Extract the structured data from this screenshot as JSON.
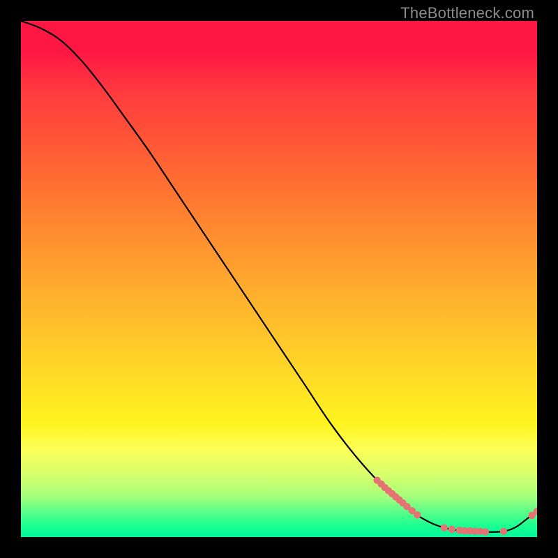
{
  "watermark": "TheBottleneck.com",
  "colors": {
    "line": "#000000",
    "dots": "#e57373",
    "background_black": "#000000"
  },
  "chart_data": {
    "type": "line",
    "title": "",
    "xlabel": "",
    "ylabel": "",
    "xlim": [
      0,
      100
    ],
    "ylim": [
      0,
      100
    ],
    "grid": false,
    "legend": false,
    "series": [
      {
        "name": "curve",
        "x": [
          0,
          4,
          8,
          12,
          16,
          20,
          25,
          30,
          35,
          40,
          45,
          50,
          55,
          60,
          65,
          70,
          75,
          78,
          80,
          82,
          84,
          86,
          88,
          90,
          92,
          94,
          96,
          98,
          100
        ],
        "y": [
          100,
          98.5,
          96,
          92,
          87,
          81.5,
          74.5,
          67,
          59.5,
          52,
          44.5,
          37,
          29.5,
          22,
          15.5,
          10,
          5.5,
          3.5,
          2.5,
          1.8,
          1.4,
          1.2,
          1.1,
          1.0,
          1.0,
          1.2,
          2.0,
          3.5,
          5.0
        ]
      }
    ],
    "markers": [
      {
        "name": "upper-cluster",
        "color": "#e57373",
        "points": [
          {
            "x": 69.0,
            "y": 11.0
          },
          {
            "x": 69.8,
            "y": 10.3
          },
          {
            "x": 70.5,
            "y": 9.6
          },
          {
            "x": 71.2,
            "y": 9.0
          },
          {
            "x": 71.9,
            "y": 8.4
          },
          {
            "x": 72.6,
            "y": 7.8
          },
          {
            "x": 73.3,
            "y": 7.2
          },
          {
            "x": 74.0,
            "y": 6.6
          },
          {
            "x": 74.8,
            "y": 5.9
          },
          {
            "x": 75.8,
            "y": 5.1
          },
          {
            "x": 76.8,
            "y": 4.3
          }
        ]
      },
      {
        "name": "floor-cluster",
        "color": "#e57373",
        "points": [
          {
            "x": 82.0,
            "y": 1.8
          },
          {
            "x": 83.5,
            "y": 1.5
          },
          {
            "x": 85.0,
            "y": 1.3
          },
          {
            "x": 86.0,
            "y": 1.2
          },
          {
            "x": 87.0,
            "y": 1.2
          },
          {
            "x": 88.0,
            "y": 1.1
          },
          {
            "x": 89.0,
            "y": 1.1
          },
          {
            "x": 90.0,
            "y": 1.0
          },
          {
            "x": 93.5,
            "y": 1.1
          }
        ]
      },
      {
        "name": "tail-cluster",
        "color": "#e57373",
        "points": [
          {
            "x": 99.0,
            "y": 4.2
          },
          {
            "x": 100.0,
            "y": 5.0
          }
        ]
      }
    ],
    "background_gradient_stops": [
      {
        "pos": 0.0,
        "color": "#ff1744"
      },
      {
        "pos": 0.5,
        "color": "#ffb22d"
      },
      {
        "pos": 0.78,
        "color": "#fff31f"
      },
      {
        "pos": 0.92,
        "color": "#a8ff7b"
      },
      {
        "pos": 1.0,
        "color": "#00f79a"
      }
    ]
  }
}
